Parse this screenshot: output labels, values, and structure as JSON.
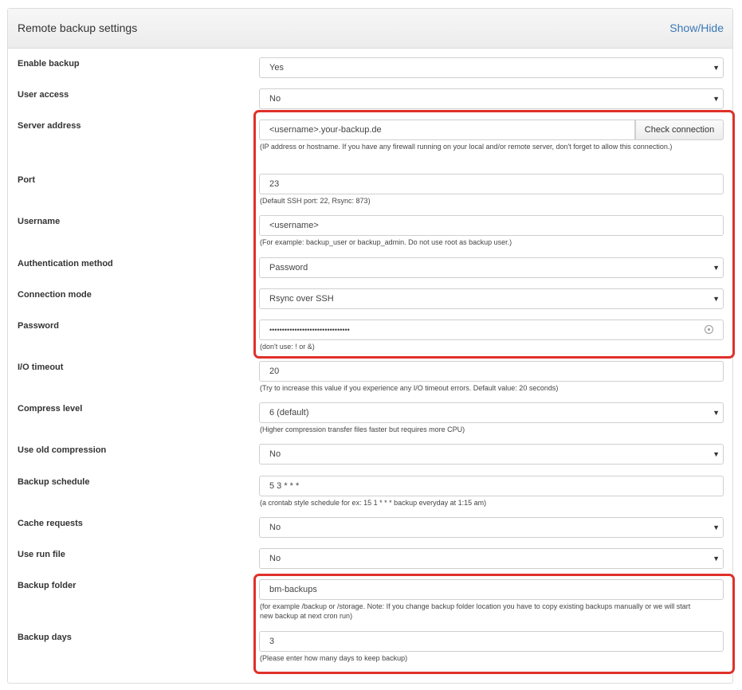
{
  "panel": {
    "title": "Remote backup settings",
    "toggle": "Show/Hide"
  },
  "fields": {
    "enable_backup": {
      "label": "Enable backup",
      "value": "Yes"
    },
    "user_access": {
      "label": "User access",
      "value": "No"
    },
    "server_address": {
      "label": "Server address",
      "value": "<username>.your-backup.de",
      "button": "Check connection",
      "help": "(IP address or hostname. If you have any firewall running on your local and/or remote server, don't forget to allow this connection.)"
    },
    "port": {
      "label": "Port",
      "value": "23",
      "help": "(Default SSH port: 22, Rsync: 873)"
    },
    "username": {
      "label": "Username",
      "value": "<username>",
      "help": "(For example: backup_user or backup_admin. Do not use root as backup user.)"
    },
    "auth_method": {
      "label": "Authentication method",
      "value": "Password"
    },
    "connection_mode": {
      "label": "Connection mode",
      "value": "Rsync over SSH"
    },
    "password": {
      "label": "Password",
      "value": "••••••••••••••••••••••••••••••••",
      "help": "(don't use: ! or &)"
    },
    "io_timeout": {
      "label": "I/O timeout",
      "value": "20",
      "help": "(Try to increase this value if you experience any I/O timeout errors. Default value: 20 seconds)"
    },
    "compress_level": {
      "label": "Compress level",
      "value": "6 (default)",
      "help": "(Higher compression transfer files faster but requires more CPU)"
    },
    "old_compression": {
      "label": "Use old compression",
      "value": "No"
    },
    "backup_schedule": {
      "label": "Backup schedule",
      "value": "5 3 * * *",
      "help": "(a crontab style schedule for ex: 15 1 * * * backup everyday at 1:15 am)"
    },
    "cache_requests": {
      "label": "Cache requests",
      "value": "No"
    },
    "run_file": {
      "label": "Use run file",
      "value": "No"
    },
    "backup_folder": {
      "label": "Backup folder",
      "value": "bm-backups",
      "help_line1": "(for example /backup or /storage. Note: If you change backup folder location you have to copy existing backups manually or we will start",
      "help_line2": "new backup at next cron run)"
    },
    "backup_days": {
      "label": "Backup days",
      "value": "3",
      "help": "(Please enter how many days to keep backup)"
    }
  },
  "caret": "▼",
  "highlight_color": "#e0302a",
  "icons": {
    "select_caret": "chevron-down-icon",
    "password_toggle": "eye-icon"
  }
}
